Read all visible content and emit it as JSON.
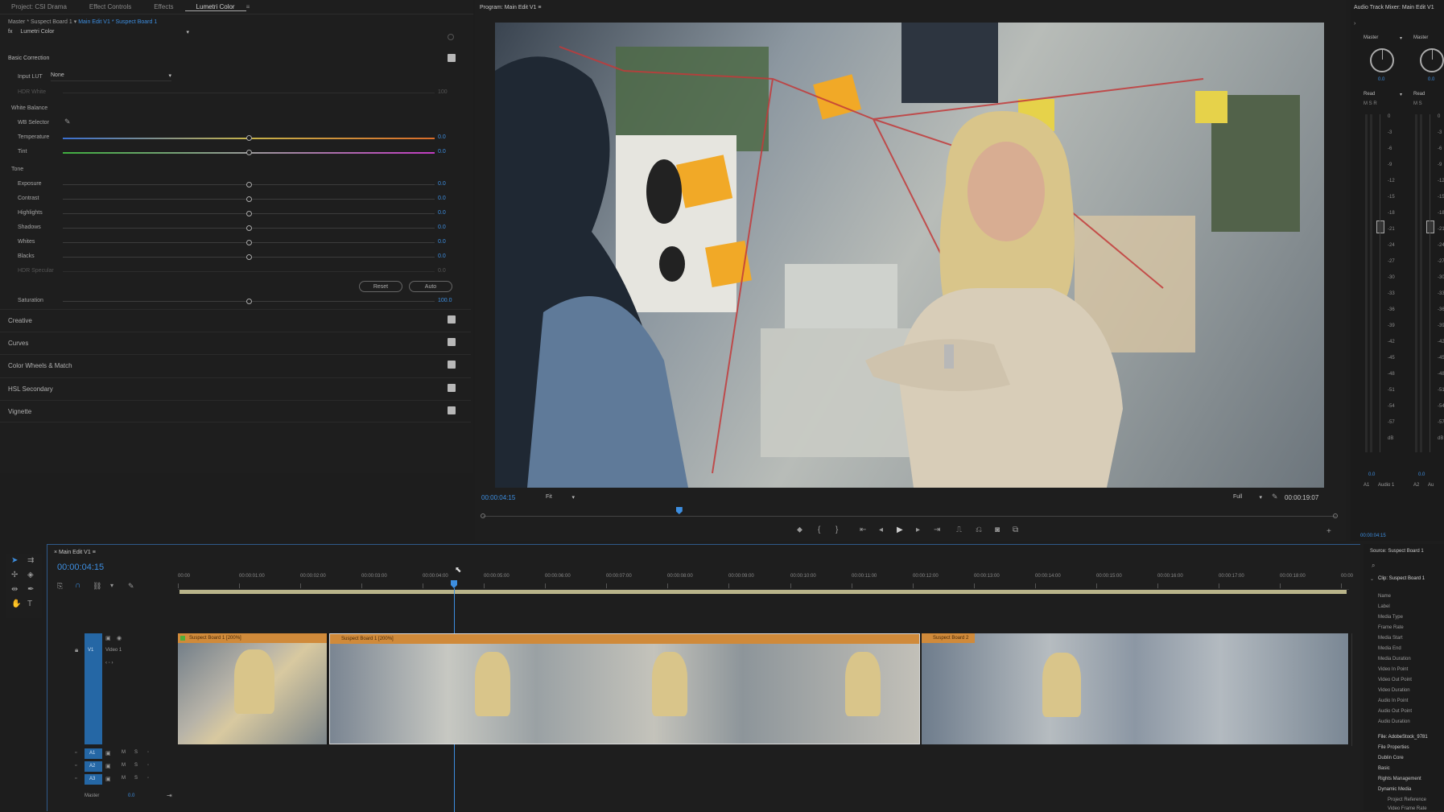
{
  "left_tabs": [
    "Project: CSI Drama",
    "Effect Controls",
    "Effects",
    "Lumetri Color"
  ],
  "breadcrumb": {
    "master": "Master * Suspect Board 1",
    "sequence": "Main Edit V1 * Suspect Board 1"
  },
  "effect_name": "Lumetri Color",
  "basic": {
    "title": "Basic Correction",
    "input_lut_label": "Input LUT",
    "input_lut_value": "None",
    "hdr_white_label": "HDR White",
    "hdr_white_value": "100",
    "white_balance": "White Balance",
    "wb_selector": "WB Selector",
    "temperature": "Temperature",
    "temperature_value": "0.0",
    "tint": "Tint",
    "tint_value": "0.0",
    "tone": "Tone",
    "tone_rows": [
      {
        "label": "Exposure",
        "value": "0.0"
      },
      {
        "label": "Contrast",
        "value": "0.0"
      },
      {
        "label": "Highlights",
        "value": "0.0"
      },
      {
        "label": "Shadows",
        "value": "0.0"
      },
      {
        "label": "Whites",
        "value": "0.0"
      },
      {
        "label": "Blacks",
        "value": "0.0"
      },
      {
        "label": "HDR Specular",
        "value": "0.0"
      }
    ],
    "reset": "Reset",
    "auto": "Auto",
    "saturation": "Saturation",
    "saturation_value": "100.0"
  },
  "sections": [
    "Creative",
    "Curves",
    "Color Wheels & Match",
    "HSL Secondary",
    "Vignette"
  ],
  "program": {
    "title": "Program: Main Edit V1",
    "timecode": "00:00:04:15",
    "fit": "Fit",
    "resolution": "Full",
    "duration": "00:00:19:07",
    "playhead_fraction": 0.23
  },
  "mixer": {
    "title": "Audio Track Mixer: Main Edit V1",
    "channels": [
      {
        "name": "Master",
        "mode": "Read",
        "pan": "0.0",
        "bottom_value": "0.0",
        "track": "A1",
        "track_name": "Audio 1"
      },
      {
        "name": "Master",
        "mode": "Read",
        "pan": "0.0",
        "bottom_value": "0.0",
        "track": "A2",
        "track_name": "Au"
      }
    ],
    "scale": [
      "0",
      "-3",
      "-6",
      "-9",
      "-12",
      "-15",
      "-18",
      "-21",
      "-24",
      "-27",
      "-30",
      "-33",
      "-36",
      "-39",
      "-42",
      "-45",
      "-48",
      "-51",
      "-54",
      "-57",
      "dB"
    ],
    "time": "00:00:04:15"
  },
  "timeline": {
    "tab": "Main Edit V1",
    "timecode": "00:00:04:15",
    "ticks": [
      "00:00",
      "00:00:01:00",
      "00:00:02:00",
      "00:00:03:00",
      "00:00:04:00",
      "00:00:05:00",
      "00:00:06:00",
      "00:00:07:00",
      "00:00:08:00",
      "00:00:09:00",
      "00:00:10:00",
      "00:00:11:00",
      "00:00:12:00",
      "00:00:13:00",
      "00:00:14:00",
      "00:00:15:00",
      "00:00:16:00",
      "00:00:17:00",
      "00:00:18:00",
      "00:00"
    ],
    "video_track": {
      "id": "V1",
      "name": "Video 1"
    },
    "audio_tracks": [
      "A1",
      "A2",
      "A3"
    ],
    "master_label": "Master",
    "master_value": "0.0",
    "clips": [
      {
        "name": "Suspect Board 1 [200%]"
      },
      {
        "name": "Suspect Board 1 [200%]"
      },
      {
        "name": "Suspect Board 2"
      }
    ]
  },
  "source": {
    "title": "Source: Suspect Board 1",
    "clip_header": "Clip: Suspect Board 1",
    "fields": [
      "Name",
      "Label",
      "Media Type",
      "Frame Rate",
      "Media Start",
      "Media End",
      "Media Duration",
      "Video In Point",
      "Video Out Point",
      "Video Duration",
      "Audio In Point",
      "Audio Out Point",
      "Audio Duration"
    ],
    "file_header": "File: AdobeStock_9781",
    "file_items": [
      "File Properties",
      "Dublin Core",
      "Basic",
      "Rights Management",
      "Dynamic Media"
    ],
    "sub_items": [
      "Project Reference",
      "Video Frame Rate"
    ]
  },
  "colors": {
    "accent": "#3d8ee0",
    "clip_orange": "#d08a3a",
    "track_blue": "#2567a5"
  }
}
